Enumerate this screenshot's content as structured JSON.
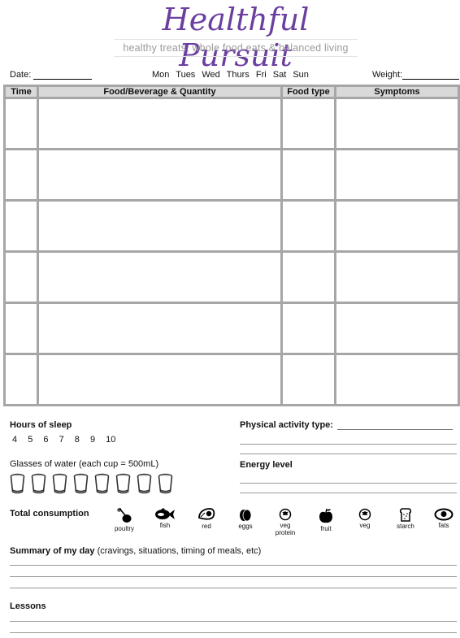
{
  "header": {
    "logo_title": "Healthful Pursuit",
    "logo_tagline": "healthy treats, whole food eats & balanced living"
  },
  "meta": {
    "date_label": "Date:",
    "days": [
      "Mon",
      "Tues",
      "Wed",
      "Thurs",
      "Fri",
      "Sat",
      "Sun"
    ],
    "weight_label": "Weight:"
  },
  "log_table": {
    "columns": [
      "Time",
      "Food/Beverage & Quantity",
      "Food type",
      "Symptoms"
    ],
    "row_count": 6
  },
  "sleep": {
    "label": "Hours of sleep",
    "options": [
      "4",
      "5",
      "6",
      "7",
      "8",
      "9",
      "10"
    ]
  },
  "water": {
    "label": "Glasses of water (each cup = 500mL)",
    "glass_count": 8,
    "glass_icon": "glass-icon"
  },
  "activity": {
    "label": "Physical activity type:"
  },
  "energy": {
    "label": "Energy level"
  },
  "consumption": {
    "label": "Total consumption",
    "items": [
      {
        "icon": "poultry-icon",
        "label": "poultry"
      },
      {
        "icon": "fish-icon",
        "label": "fish"
      },
      {
        "icon": "red-meat-icon",
        "label": "red"
      },
      {
        "icon": "eggs-icon",
        "label": "eggs"
      },
      {
        "icon": "veg-protein-icon",
        "label": "veg protein"
      },
      {
        "icon": "fruit-icon",
        "label": "fruit"
      },
      {
        "icon": "veg-icon",
        "label": "veg"
      },
      {
        "icon": "starch-icon",
        "label": "starch"
      },
      {
        "icon": "fats-icon",
        "label": "fats"
      }
    ]
  },
  "summary": {
    "label_bold": "Summary of my day",
    "label_note": " (cravings, situations, timing of meals, etc)"
  },
  "lessons": {
    "label": "Lessons"
  },
  "colors": {
    "brand": "#6b3fa0",
    "table_border": "#a6a6a6",
    "header_fill": "#d9d9d9"
  }
}
